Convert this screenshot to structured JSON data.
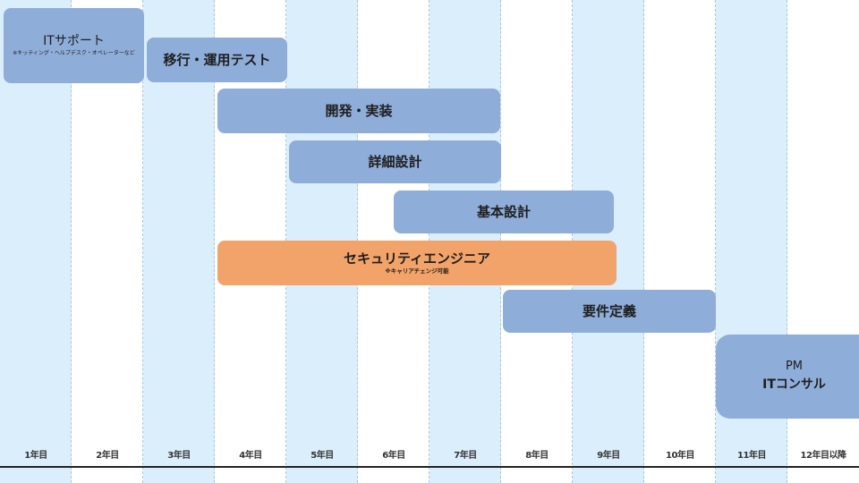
{
  "years": [
    "1年目",
    "2年目",
    "3年目",
    "4年目",
    "5年目",
    "6年目",
    "7年目",
    "8年目",
    "9年目",
    "10年目",
    "11年目",
    "12年目以降"
  ],
  "bars": {
    "it_support": {
      "title": "ITサポート",
      "note": "※キッティング・ヘルプデスク・オペレーターなど"
    },
    "migration_test": {
      "title": "移行・運用テスト"
    },
    "development": {
      "title": "開発・実装"
    },
    "detailed_design": {
      "title": "詳細設計"
    },
    "basic_design": {
      "title": "基本設計"
    },
    "security_engineer": {
      "title": "セキュリティエンジニア",
      "note": "※キャリアチェンジ可能"
    },
    "requirements": {
      "title": "要件定義"
    },
    "pm_consultant": {
      "line1": "PM",
      "line2": "ITコンサル"
    }
  },
  "colors": {
    "shaded_column": "#daeefc",
    "bar_blue": "#8fadd9",
    "bar_orange": "#f2a36a"
  }
}
